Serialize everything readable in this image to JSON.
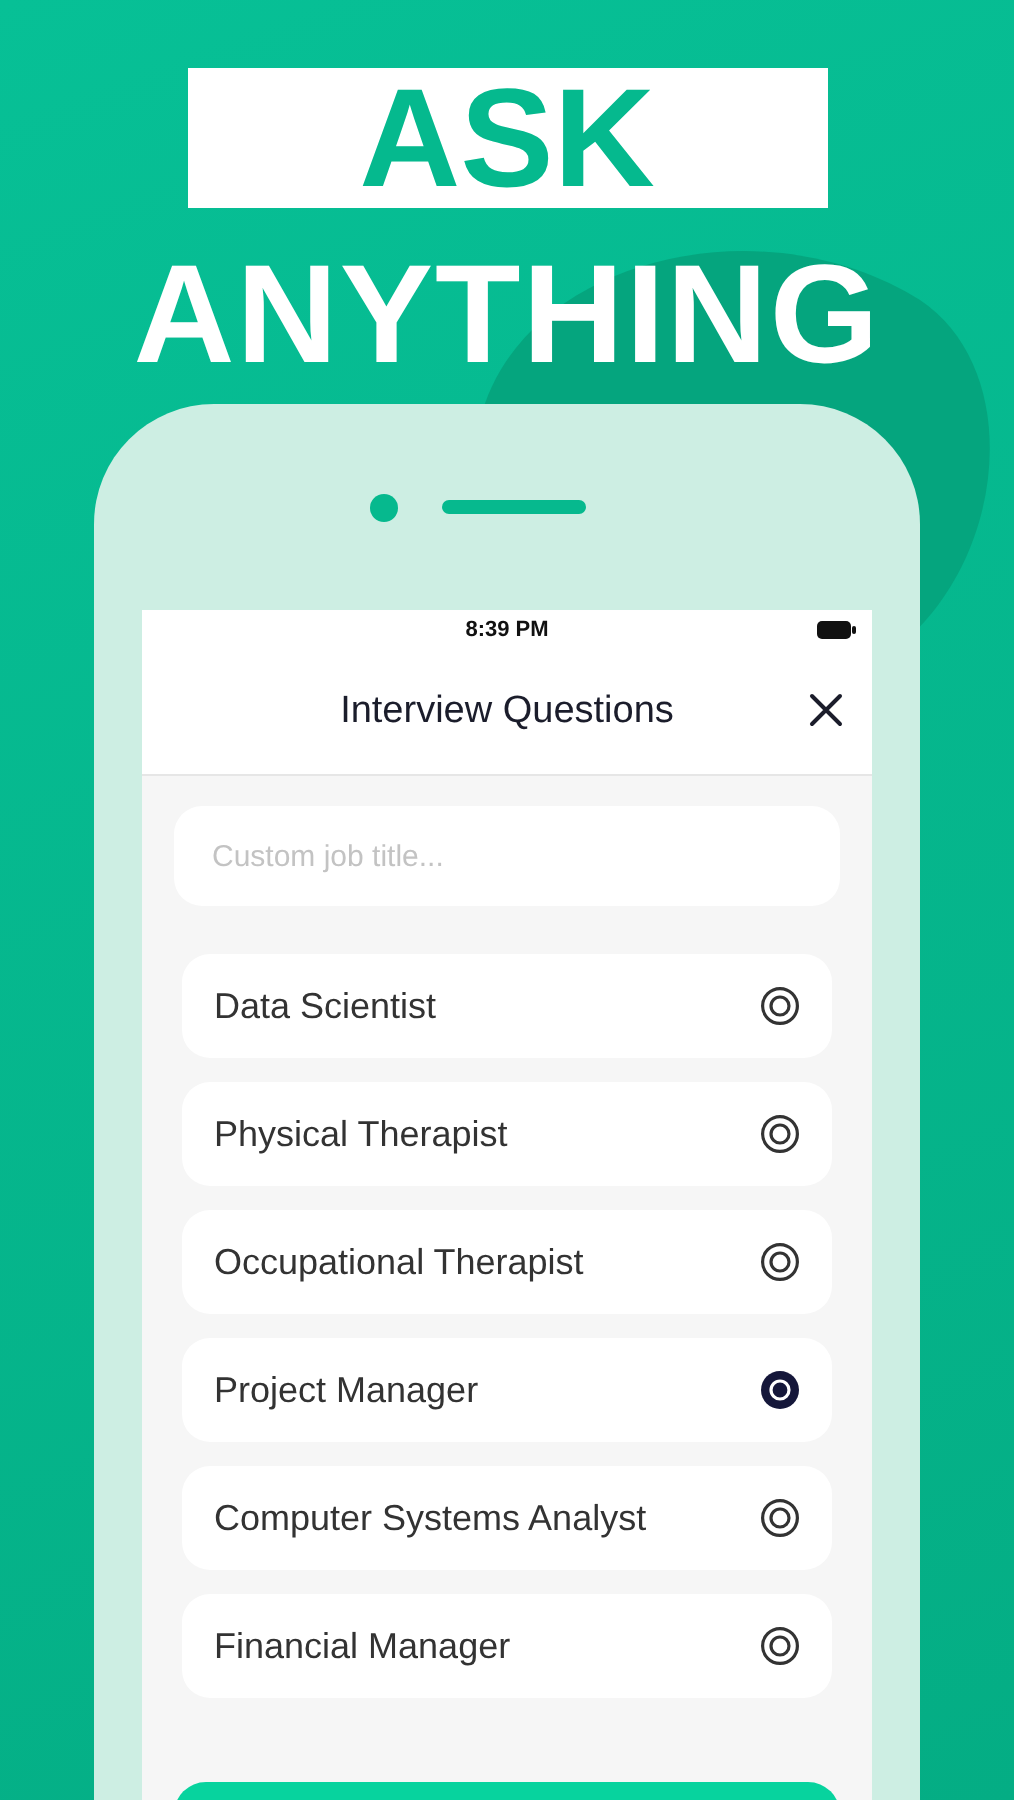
{
  "headline": {
    "boxed_text": "ASK",
    "text": "ANYTHING"
  },
  "status_bar": {
    "time": "8:39 PM"
  },
  "header": {
    "title": "Interview Questions"
  },
  "search": {
    "placeholder": "Custom job title..."
  },
  "jobs": [
    {
      "label": "Data Scientist",
      "selected": false
    },
    {
      "label": "Physical Therapist",
      "selected": false
    },
    {
      "label": "Occupational Therapist",
      "selected": false
    },
    {
      "label": "Project Manager",
      "selected": true
    },
    {
      "label": "Computer Systems Analyst",
      "selected": false
    },
    {
      "label": "Financial Manager",
      "selected": false
    }
  ]
}
